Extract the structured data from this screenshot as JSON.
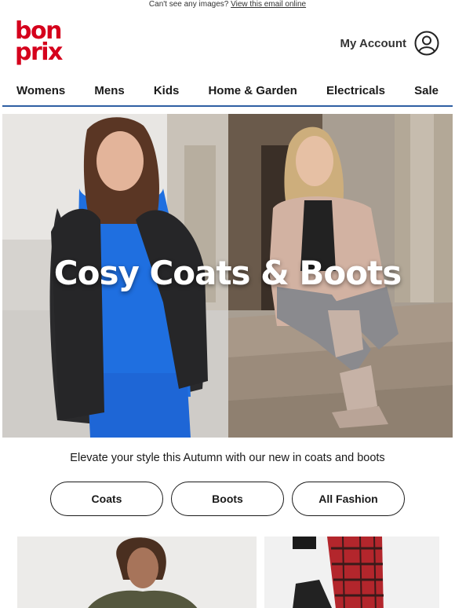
{
  "preheader": {
    "text": "Can't see any images?",
    "link": "View this email online"
  },
  "brand": {
    "logo_line1": "bon",
    "logo_line2": "prix",
    "color": "#d5001c"
  },
  "account": {
    "label": "My Account",
    "icon": "user-circle-icon"
  },
  "nav": {
    "items": [
      {
        "label": "Womens"
      },
      {
        "label": "Mens"
      },
      {
        "label": "Kids"
      },
      {
        "label": "Home & Garden"
      },
      {
        "label": "Electricals"
      },
      {
        "label": "Sale"
      }
    ],
    "rule_color": "#2f5fa3"
  },
  "hero": {
    "title": "Cosy Coats & Boots"
  },
  "tagline": "Elevate your style this Autumn with our new in coats and boots",
  "ctas": [
    {
      "label": "Coats"
    },
    {
      "label": "Boots"
    },
    {
      "label": "All Fashion"
    }
  ]
}
